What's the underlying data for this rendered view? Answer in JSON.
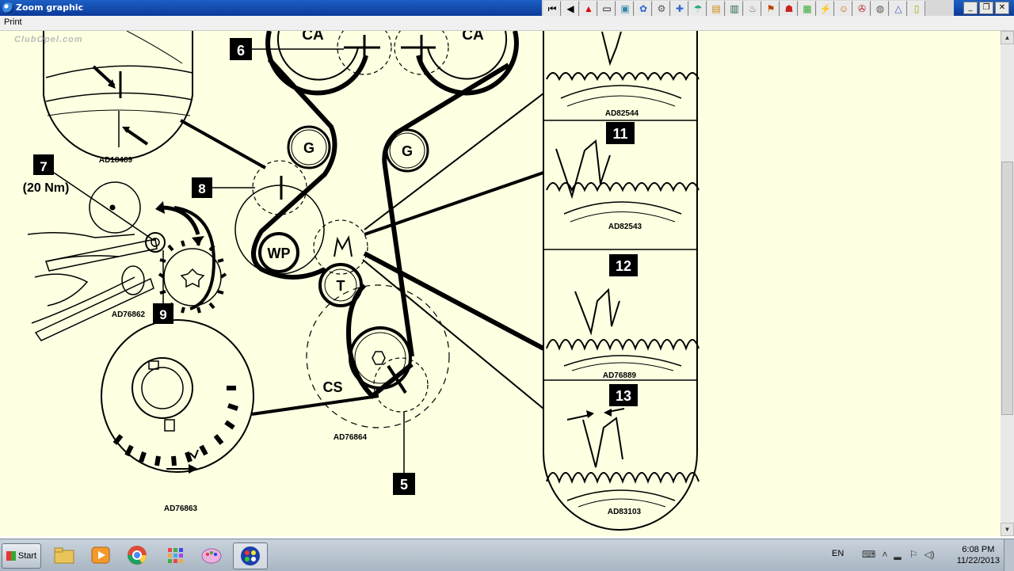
{
  "window": {
    "title": "Zoom graphic"
  },
  "menu": {
    "print_label": "Print"
  },
  "watermark": "ClubOpel.com",
  "toolbar": {
    "icons": [
      "first-page-icon",
      "previous-icon",
      "warning-icon",
      "blank-page-icon",
      "image-icon",
      "gear-tool-icon",
      "engine-icon",
      "wrench-icon",
      "fuel-icon",
      "battery-icon",
      "car-lift-icon",
      "oil-can-icon",
      "car-icon",
      "display-icon",
      "document-stack-icon",
      "lightning-icon",
      "car-repair-icon",
      "network-icon",
      "globe-icon",
      "triangle-warning-icon",
      "note-icon"
    ]
  },
  "diagram": {
    "labels": {
      "ca_left": "CA",
      "ca_right": "CA",
      "g_left": "G",
      "g_right": "G",
      "wp": "WP",
      "t": "T",
      "cs": "CS",
      "m": "M",
      "torque": "(20 Nm)"
    },
    "callouts": {
      "c5": "5",
      "c6": "6",
      "c7": "7",
      "c8": "8",
      "c9": "9",
      "c11": "11",
      "c12": "12",
      "c13": "13"
    },
    "codes": {
      "ad18489": "AD18489",
      "ad76862": "AD76862",
      "ad76863": "AD76863",
      "ad76864": "AD76864",
      "ad82544": "AD82544",
      "ad82543": "AD82543",
      "ad76889": "AD76889",
      "ad83103": "AD83103"
    }
  },
  "taskbar": {
    "start_label": "Start",
    "apps": [
      "file-explorer-icon",
      "media-player-icon",
      "chrome-icon",
      "apps-grid-icon",
      "paint-icon",
      "opel-app-icon"
    ],
    "language": "EN",
    "time": "6:08 PM",
    "date": "11/22/2013"
  },
  "colors": {
    "canvas_bg": "#ffffe2",
    "titlebar": "#0b3a99",
    "taskbar": "#b8c4cf"
  }
}
